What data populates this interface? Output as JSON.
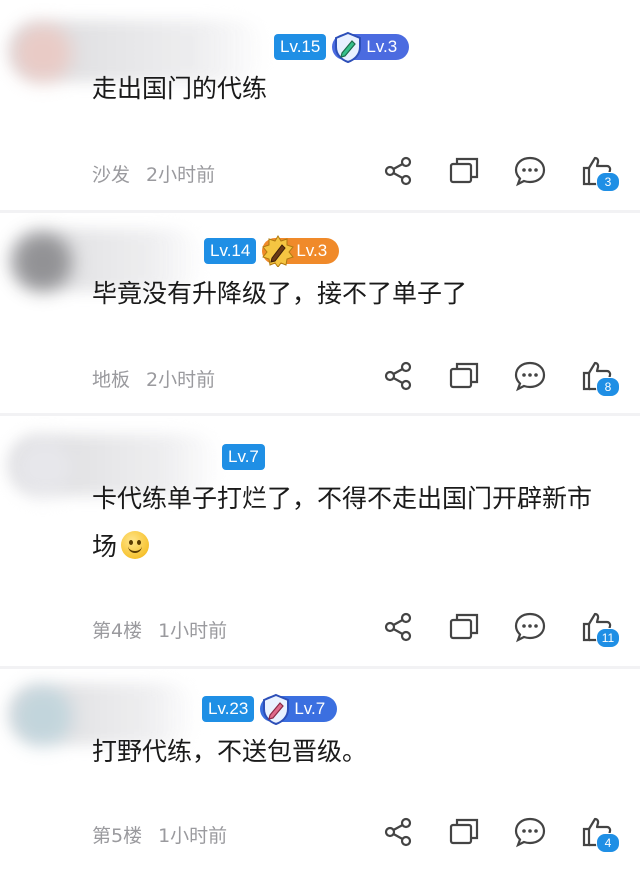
{
  "comments": [
    {
      "level": "Lv.15",
      "medal": {
        "label": "Lv.3",
        "color": "#4b6be0",
        "icon": "pen-shield-icon"
      },
      "text": "走出国门的代练",
      "floor": "沙发",
      "time": "2小时前",
      "likes": "3"
    },
    {
      "level": "Lv.14",
      "medal": {
        "label": "Lv.3",
        "color": "#f08a2a",
        "icon": "gold-pen-badge-icon"
      },
      "text": "毕竟没有升降级了，接不了单子了",
      "floor": "地板",
      "time": "2小时前",
      "likes": "8"
    },
    {
      "level": "Lv.7",
      "text_line1": "卡代练单子打烂了，不得不走出国门开辟新市",
      "text_line2": "场",
      "emoji": "smile-emoji",
      "floor": "第4楼",
      "time": "1小时前",
      "likes": "11"
    },
    {
      "level": "Lv.23",
      "medal": {
        "label": "Lv.7",
        "color": "#3b6fe0",
        "icon": "pen-shield-icon"
      },
      "text": "打野代练，不送包晋级。",
      "floor": "第5楼",
      "time": "1小时前",
      "likes": "4"
    }
  ],
  "actions": [
    "share-icon",
    "copy-icon",
    "comment-icon",
    "thumbs-up-icon"
  ],
  "colors": {
    "accent": "#1f8fe5",
    "meta": "#9a9a9e",
    "icon": "#444444"
  }
}
